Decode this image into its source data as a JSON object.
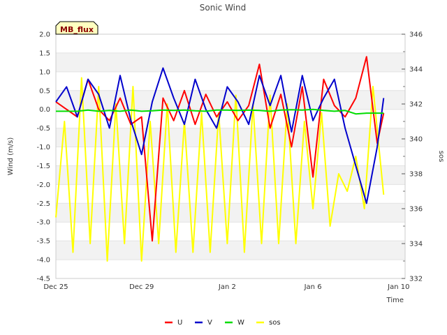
{
  "chart_data": {
    "type": "line",
    "title": "Sonic Wind",
    "badge": "MB_flux",
    "xlabel": "Time",
    "ylabel_left": "Wind (m/s)",
    "ylabel_right": "sos",
    "x_start": "Dec 25",
    "x_end_days": 15.3,
    "x_range_days": [
      0,
      16.3
    ],
    "x_ticks": [
      {
        "label": "Dec 25",
        "day": 0
      },
      {
        "label": "Dec 29",
        "day": 4
      },
      {
        "label": "Jan 2",
        "day": 8
      },
      {
        "label": "Jan 6",
        "day": 12
      },
      {
        "label": "Jan 10",
        "day": 16
      }
    ],
    "ylim_left": [
      -4.5,
      2.0
    ],
    "yticks_left": [
      "2.0",
      "1.5",
      "1.0",
      "0.5",
      "0.0",
      "-0.5",
      "-1.0",
      "-1.5",
      "-2.0",
      "-2.5",
      "-3.0",
      "-3.5",
      "-4.0",
      "-4.5"
    ],
    "ylim_right": [
      332,
      346
    ],
    "yticks_right": [
      "346",
      "344",
      "342",
      "340",
      "338",
      "336",
      "334",
      "332"
    ],
    "grid": "horizontal-bands",
    "legend_position": "bottom-center",
    "series": [
      {
        "name": "U",
        "color": "#ff0000",
        "axis": "left",
        "x": [
          0,
          0.5,
          1,
          1.5,
          2,
          2.5,
          3,
          3.5,
          4,
          4.5,
          5,
          5.5,
          6,
          6.5,
          7,
          7.5,
          8,
          8.5,
          9,
          9.5,
          10,
          10.5,
          11,
          11.5,
          12,
          12.5,
          13,
          13.5,
          14,
          14.5,
          15,
          15.3
        ],
        "y": [
          0.2,
          0,
          -0.2,
          0.8,
          0,
          -0.3,
          0.3,
          -0.4,
          -0.2,
          -3.5,
          0.3,
          -0.3,
          0.5,
          -0.4,
          0.4,
          -0.2,
          0.2,
          -0.3,
          0.1,
          1.2,
          -0.5,
          0.4,
          -1.0,
          0.6,
          -1.8,
          0.8,
          0.1,
          -0.2,
          0.3,
          1.4,
          -0.9,
          -0.1
        ]
      },
      {
        "name": "V",
        "color": "#0000cc",
        "axis": "left",
        "x": [
          0,
          0.5,
          1,
          1.5,
          2,
          2.5,
          3,
          3.5,
          4,
          4.5,
          5,
          5.5,
          6,
          6.5,
          7,
          7.5,
          8,
          8.5,
          9,
          9.5,
          10,
          10.5,
          11,
          11.5,
          12,
          12.5,
          13,
          13.5,
          14,
          14.5,
          15,
          15.3
        ],
        "y": [
          0.2,
          0.6,
          -0.2,
          0.8,
          0.4,
          -0.5,
          0.9,
          -0.3,
          -1.2,
          0.2,
          1.1,
          0.3,
          -0.4,
          0.8,
          0,
          -0.5,
          0.6,
          0.2,
          -0.4,
          0.9,
          0.1,
          0.9,
          -0.6,
          0.9,
          -0.3,
          0.3,
          0.8,
          -0.5,
          -1.5,
          -2.5,
          -1.0,
          0.3
        ]
      },
      {
        "name": "W",
        "color": "#00dd00",
        "axis": "left",
        "x": [
          0,
          0.5,
          1,
          1.5,
          2,
          2.5,
          3,
          3.5,
          4,
          4.5,
          5,
          5.5,
          6,
          6.5,
          7,
          7.5,
          8,
          8.5,
          9,
          9.5,
          10,
          10.5,
          11,
          11.5,
          12,
          12.5,
          13,
          13.5,
          14,
          14.5,
          15,
          15.3
        ],
        "y": [
          -0.05,
          -0.05,
          -0.05,
          -0.02,
          -0.05,
          -0.03,
          -0.05,
          -0.02,
          -0.05,
          -0.04,
          -0.02,
          -0.03,
          -0.02,
          -0.04,
          -0.05,
          -0.02,
          -0.02,
          -0.03,
          -0.02,
          -0.03,
          -0.05,
          -0.02,
          -0.01,
          -0.02,
          0,
          -0.03,
          -0.05,
          -0.03,
          -0.12,
          -0.1,
          -0.1,
          -0.1
        ]
      },
      {
        "name": "sos",
        "color": "#ffff00",
        "axis": "right",
        "x": [
          0,
          0.4,
          0.8,
          1.2,
          1.6,
          2.0,
          2.4,
          2.8,
          3.2,
          3.6,
          4.0,
          4.4,
          4.8,
          5.2,
          5.6,
          6.0,
          6.4,
          6.8,
          7.2,
          7.6,
          8.0,
          8.4,
          8.8,
          9.2,
          9.6,
          10.0,
          10.4,
          10.8,
          11.2,
          11.6,
          12.0,
          12.4,
          12.8,
          13.2,
          13.6,
          14.0,
          14.4,
          14.8,
          15.2,
          15.3
        ],
        "y": [
          335.5,
          341,
          333.5,
          343.5,
          334,
          343,
          333,
          342,
          334,
          343,
          333,
          341,
          334,
          342,
          333.5,
          341,
          333.5,
          341.5,
          333.5,
          341.5,
          334,
          342.5,
          333.5,
          342,
          334,
          342.5,
          334,
          342,
          334,
          341,
          336,
          341.5,
          335,
          338,
          337,
          339,
          336,
          343,
          338,
          336.8
        ]
      }
    ]
  },
  "legend": {
    "items": [
      {
        "label": "U",
        "color": "#ff0000"
      },
      {
        "label": "V",
        "color": "#0000cc"
      },
      {
        "label": "W",
        "color": "#00dd00"
      },
      {
        "label": "sos",
        "color": "#ffff00"
      }
    ]
  }
}
